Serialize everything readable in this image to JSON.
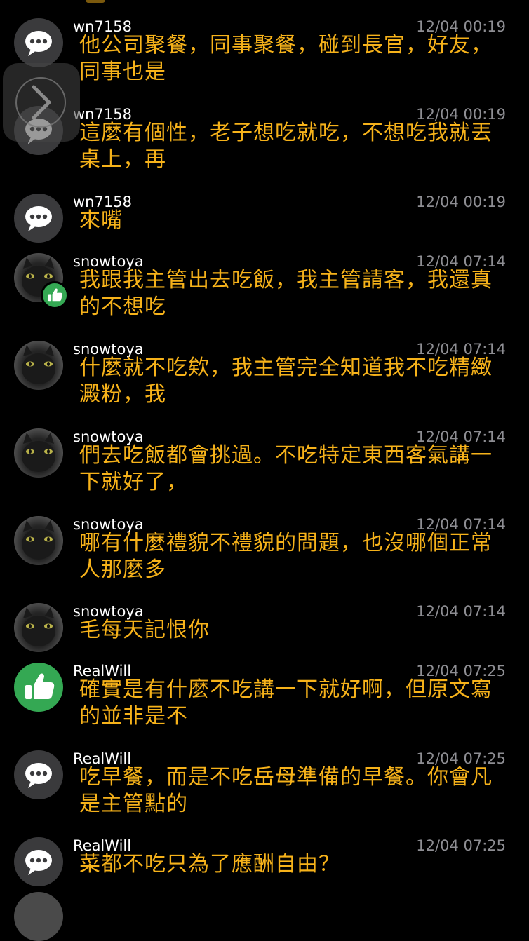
{
  "comments": [
    {
      "avatar": "chat-bubble-icon",
      "badge": "",
      "username": "wn7158",
      "timestamp": "12/04 00:19",
      "text": "他公司聚餐，同事聚餐，碰到長官，好友，同事也是"
    },
    {
      "avatar": "chat-bubble-icon",
      "badge": "",
      "username": "wn7158",
      "timestamp": "12/04 00:19",
      "text": "這麼有個性，老子想吃就吃，不想吃我就丟桌上，再"
    },
    {
      "avatar": "chat-bubble-icon",
      "badge": "",
      "username": "wn7158",
      "timestamp": "12/04 00:19",
      "text": "來嘴"
    },
    {
      "avatar": "cat-photo",
      "badge": "thumbs-up-icon",
      "username": "snowtoya",
      "timestamp": "12/04 07:14",
      "text": "我跟我主管出去吃飯，我主管請客，我還真的不想吃"
    },
    {
      "avatar": "cat-photo",
      "badge": "",
      "username": "snowtoya",
      "timestamp": "12/04 07:14",
      "text": "什麼就不吃欸，我主管完全知道我不吃精緻澱粉，我"
    },
    {
      "avatar": "cat-photo",
      "badge": "",
      "username": "snowtoya",
      "timestamp": "12/04 07:14",
      "text": "們去吃飯都會挑過。不吃特定東西客氣講一下就好了，"
    },
    {
      "avatar": "cat-photo",
      "badge": "",
      "username": "snowtoya",
      "timestamp": "12/04 07:14",
      "text": "哪有什麼禮貌不禮貌的問題，也沒哪個正常人那麼多"
    },
    {
      "avatar": "cat-photo",
      "badge": "",
      "username": "snowtoya",
      "timestamp": "12/04 07:14",
      "text": "毛每天記恨你"
    },
    {
      "avatar": "thumbs-up-icon",
      "badge": "",
      "username": "RealWill",
      "timestamp": "12/04 07:25",
      "text": "確實是有什麼不吃講一下就好啊，但原文寫的並非是不"
    },
    {
      "avatar": "chat-bubble-icon",
      "badge": "",
      "username": "RealWill",
      "timestamp": "12/04 07:25",
      "text": "吃早餐，而是不吃岳母準備的早餐。你會凡是主管點的"
    },
    {
      "avatar": "chat-bubble-icon",
      "badge": "",
      "username": "RealWill",
      "timestamp": "12/04 07:25",
      "text": "菜都不吃只為了應酬自由？"
    }
  ],
  "colors": {
    "background": "#000000",
    "comment_text": "#f6b21a",
    "username": "#ffffff",
    "timestamp": "#8e8e93",
    "chat_avatar": "#3a3a3c",
    "like_green": "#34a853"
  },
  "overlay": {
    "icon": "chevron-right-icon"
  }
}
